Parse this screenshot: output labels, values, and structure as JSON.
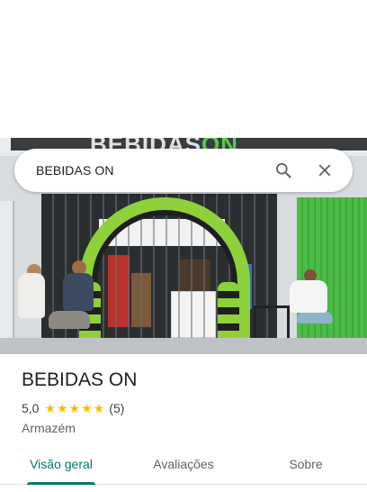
{
  "search": {
    "query": "BEBIDAS ON",
    "search_icon": "search-icon",
    "clear_icon": "close-icon"
  },
  "hero": {
    "sign_text": "BEBIDAS",
    "sign_text_accent": "ON"
  },
  "place": {
    "name": "BEBIDAS ON",
    "rating": "5,0",
    "stars": 5,
    "review_count": "(5)",
    "category": "Armazém"
  },
  "tabs": [
    {
      "label": "Visão geral",
      "active": true
    },
    {
      "label": "Avaliações",
      "active": false
    },
    {
      "label": "Sobre",
      "active": false
    }
  ],
  "colors": {
    "accent": "#00796b",
    "star": "#fbbc04"
  }
}
